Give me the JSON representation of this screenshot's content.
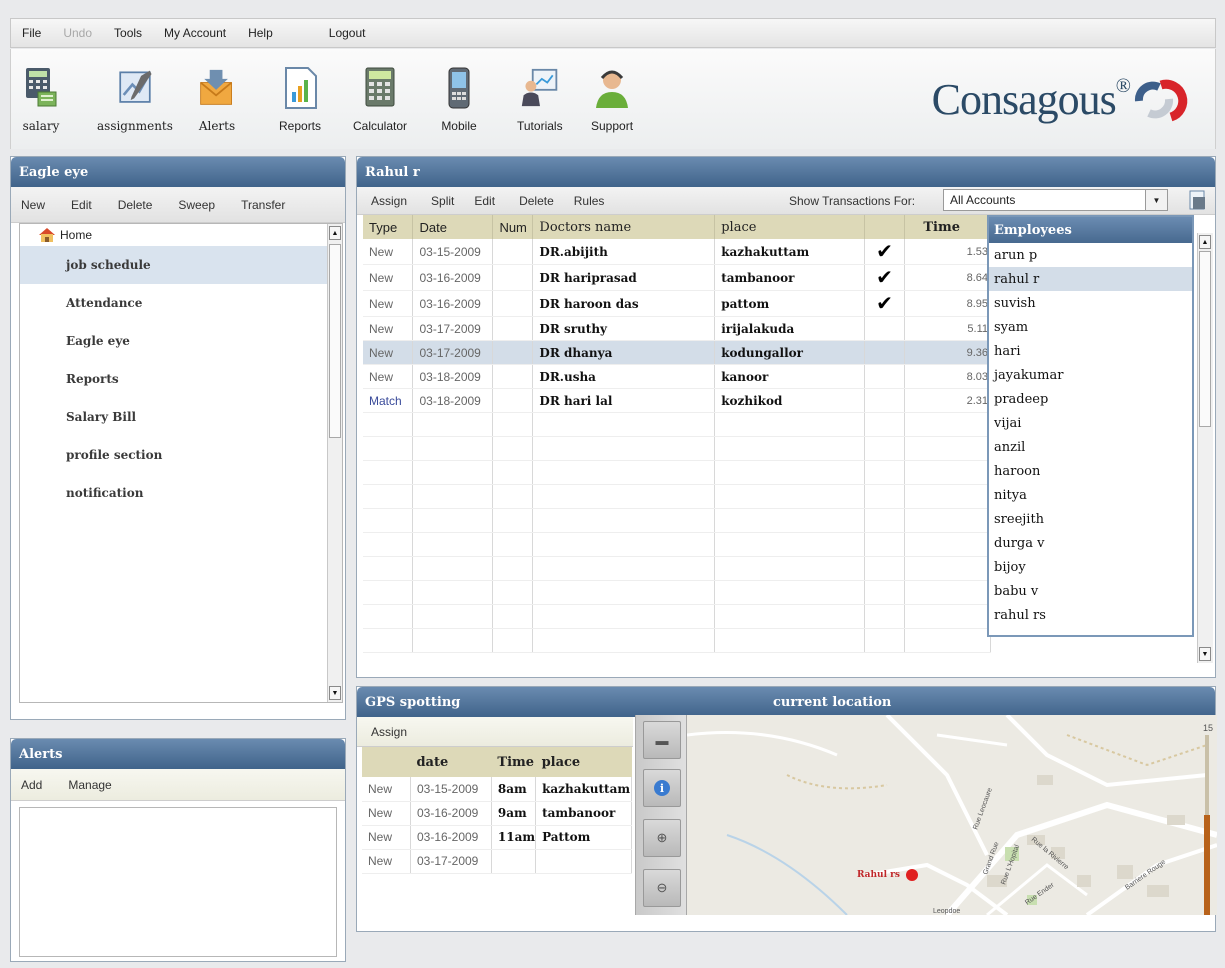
{
  "menu": [
    "File",
    "Undo",
    "Tools",
    "My Account",
    "Help",
    "Logout"
  ],
  "toolbar": {
    "salary": "salary",
    "assignments": "assignments",
    "alerts": "Alerts",
    "reports": "Reports",
    "calculator": "Calculator",
    "mobile": "Mobile",
    "tutorials": "Tutorials",
    "support": "Support"
  },
  "logo": {
    "text": "Consagous",
    "reg": "®"
  },
  "eagle": {
    "title": "Eagle eye",
    "actions": [
      "New",
      "Edit",
      "Delete",
      "Sweep",
      "Transfer"
    ],
    "home": "Home",
    "items": [
      "job schedule",
      "Attendance",
      "Eagle eye",
      "Reports",
      "Salary Bill",
      "profile section",
      "notification"
    ]
  },
  "alerts": {
    "title": "Alerts",
    "actions": [
      "Add",
      "Manage"
    ]
  },
  "register": {
    "title": "Rahul r",
    "actions": [
      "Assign",
      "Split",
      "Edit",
      "Delete",
      "Rules"
    ],
    "show_label": "Show Transactions For:",
    "account": "All Accounts",
    "columns": [
      "Type",
      "Date",
      "Num",
      "Doctors name",
      "place",
      "",
      "Time"
    ],
    "rows": [
      {
        "type": "New",
        "date": "03-15-2009",
        "num": "",
        "name": "DR.abijith",
        "place": "kazhakuttam",
        "check": "✔",
        "time": "1.53"
      },
      {
        "type": "New",
        "date": "03-16-2009",
        "num": "",
        "name": "DR hariprasad",
        "place": "tambanoor",
        "check": "✔",
        "time": "8.64"
      },
      {
        "type": "New",
        "date": "03-16-2009",
        "num": "",
        "name": "DR haroon das",
        "place": "pattom",
        "check": "✔",
        "time": "8.95"
      },
      {
        "type": "New",
        "date": "03-17-2009",
        "num": "",
        "name": "DR sruthy",
        "place": "irijalakuda",
        "check": "",
        "time": "5.11"
      },
      {
        "type": "New",
        "date": "03-17-2009",
        "num": "",
        "name": "DR dhanya",
        "place": "kodungallor",
        "check": "",
        "time": "9.36"
      },
      {
        "type": "New",
        "date": "03-18-2009",
        "num": "",
        "name": "DR.usha",
        "place": "kanoor",
        "check": "",
        "time": "8.03"
      },
      {
        "type": "Match",
        "date": "03-18-2009",
        "num": "",
        "name": "DR hari lal",
        "place": "kozhikod",
        "check": "",
        "time": "2.31"
      }
    ]
  },
  "employees": {
    "title": "Employees",
    "items": [
      "arun p",
      "rahul r",
      "suvish",
      "syam",
      "hari",
      "jayakumar",
      "pradeep",
      "vijai",
      "anzil",
      "haroon",
      "nitya",
      "sreejith",
      "durga v",
      "bijoy",
      "babu v",
      "rahul rs"
    ]
  },
  "gps": {
    "title": "GPS spotting",
    "map_title": "current location",
    "action": "Assign",
    "columns": [
      "",
      "date",
      "Time",
      "place"
    ],
    "rows": [
      {
        "type": "New",
        "date": "03-15-2009",
        "time": "8am",
        "place": "kazhakuttam"
      },
      {
        "type": "New",
        "date": "03-16-2009",
        "time": "9am",
        "place": "tambanoor"
      },
      {
        "type": "New",
        "date": "03-16-2009",
        "time": "11am",
        "place": "Pattom"
      },
      {
        "type": "New",
        "date": "03-17-2009",
        "time": "",
        "place": ""
      }
    ],
    "marker_label": "Rahul rs",
    "zoom_level": "15",
    "street_labels": [
      "Rue Leocaure",
      "Grand Rue",
      "Rue L'Hopital",
      "Rue la Rivierre",
      "Rue Ender",
      "Barriere Rouge",
      "Leopdoe"
    ]
  }
}
